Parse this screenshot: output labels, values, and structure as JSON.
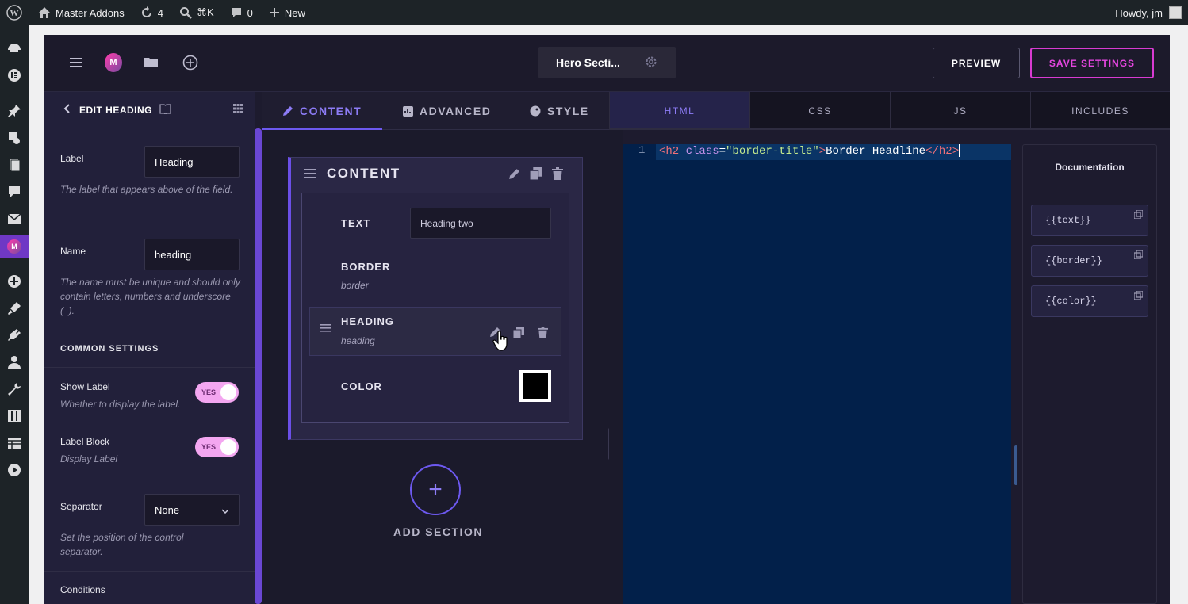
{
  "adminbar": {
    "site_name": "Master Addons",
    "updates_count": "4",
    "search_shortcut": "⌘K",
    "comments_count": "0",
    "new_label": "New",
    "howdy": "Howdy, jm"
  },
  "header": {
    "logo_text": "M",
    "title": "Hero Secti...",
    "preview_label": "PREVIEW",
    "save_label": "SAVE SETTINGS"
  },
  "left_panel": {
    "title": "EDIT HEADING",
    "label_field": {
      "label": "Label",
      "value": "Heading",
      "help": "The label that appears above of the field."
    },
    "name_field": {
      "label": "Name",
      "value": "heading",
      "help": "The name must be unique and should only contain letters, numbers and underscore (_)."
    },
    "common_settings": "COMMON SETTINGS",
    "show_label": {
      "label": "Show Label",
      "help": "Whether to display the label.",
      "toggle": "YES"
    },
    "label_block": {
      "label": "Label Block",
      "help": "Display Label",
      "toggle": "YES"
    },
    "separator": {
      "label": "Separator",
      "value": "None",
      "help": "Set the position of the control separator."
    },
    "conditions": "Conditions"
  },
  "tabs": {
    "content": "CONTENT",
    "advanced": "ADVANCED",
    "style": "STYLE"
  },
  "section": {
    "title": "CONTENT",
    "fields": [
      {
        "label": "TEXT",
        "value": "Heading two"
      },
      {
        "label": "BORDER",
        "sub": "border"
      },
      {
        "label": "HEADING",
        "sub": "heading"
      },
      {
        "label": "COLOR",
        "swatch": "#000000"
      }
    ],
    "add_section": "ADD SECTION"
  },
  "code_tabs": {
    "html": "HTML",
    "css": "CSS",
    "js": "JS",
    "includes": "INCLUDES"
  },
  "editor": {
    "line_number": "1",
    "tokens": {
      "open_tag": "<h2 ",
      "attr": "class",
      "eq": "=",
      "str": "\"border-title\"",
      "close_open": ">",
      "text": "Border Headline",
      "close_tag": "</h2>"
    }
  },
  "docs": {
    "title": "Documentation",
    "chips": [
      "{{text}}",
      "{{border}}",
      "{{color}}"
    ]
  },
  "colors": {
    "accent": "#6d59f0",
    "save": "#e546e0",
    "toggle": "#f3a6f0"
  }
}
